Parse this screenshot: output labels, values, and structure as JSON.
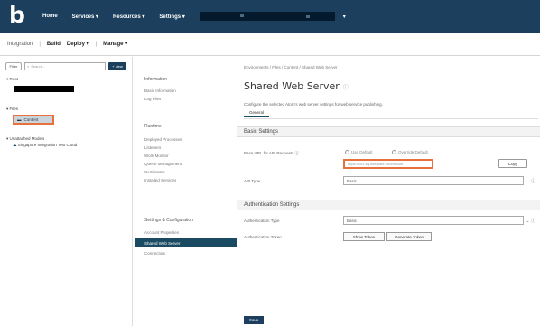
{
  "topbar": {
    "logo": "b",
    "nav": [
      "Home",
      "Services ▾",
      "Resources ▾",
      "Settings ▾"
    ],
    "account_chevron": "▾"
  },
  "subbar": {
    "items": [
      "Integration",
      "Build",
      "Deploy ▾",
      "Manage ▾"
    ]
  },
  "leftpanel": {
    "filter_label": "Filter",
    "search_placeholder": "Search...",
    "new_label": "+ New",
    "tree": {
      "root": "▾ Root",
      "files": "▾ Files",
      "content": "Content",
      "unattached": "▾ Unattached Models",
      "sub": "Singapore Integration Test Cloud"
    }
  },
  "midpanel": {
    "info_header": "Information",
    "info_items": [
      "Basic Information",
      "Log Files"
    ],
    "runtime_header": "Runtime",
    "runtime_items": [
      "Deployed Processes",
      "Listeners",
      "Work Monitor",
      "Queue Management",
      "Certificates",
      "Installed Services"
    ],
    "settings_header": "Settings & Configuration",
    "settings_items": [
      "Account Properties",
      "Shared Web Server",
      "Connectors"
    ],
    "active_index": 1
  },
  "main": {
    "breadcrumb": "Environments / Files / Content / Shared Web Server",
    "title": "Shared Web Server",
    "title_info": "ⓘ",
    "description": "Configure the selected Atom's web server settings for web service publishing.",
    "tab": "General",
    "basic_settings": "Basic Settings",
    "base_url_label": "Base URL for API Requests ⓘ",
    "radio1": "Use Default",
    "radio2": "Override Default",
    "url_value": "https://c01-sg.integrate.boomi.com",
    "copy_label": "Copy",
    "api_type_label": "API Type",
    "api_type_value": "Basic",
    "auth_settings": "Authentication Settings",
    "auth_type_label": "Authentication Type",
    "auth_type_value": "Basic",
    "auth_token_label": "Authentication Token",
    "show_token": "Show Token",
    "generate_token": "Generate Token",
    "save_label": "Save"
  }
}
